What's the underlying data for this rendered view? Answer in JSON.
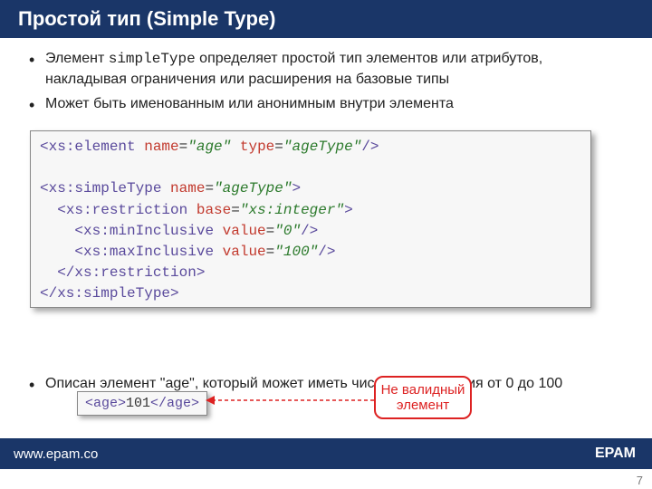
{
  "header": {
    "title": "Простой тип (Simple Type)"
  },
  "bullets": {
    "b1_pre": "Элемент ",
    "b1_code": "simpleType",
    "b1_post": " определяет простой тип элементов или атрибутов, накладывая ограничения или расширения на базовые типы",
    "b2": "Может быть именованным или анонимным внутри элемента",
    "b3": "Описан элемент \"age\", который может иметь числовые значения от 0 до 100"
  },
  "code": {
    "l1a": "<",
    "l1b": "xs:element",
    "l1c": " name",
    "l1d": "=",
    "l1e": "\"age\"",
    "l1f": " type",
    "l1g": "=",
    "l1h": "\"ageType\"",
    "l1i": "/>",
    "l2": "",
    "l3a": "<",
    "l3b": "xs:simpleType",
    "l3c": " name",
    "l3d": "=",
    "l3e": "\"ageType\"",
    "l3f": ">",
    "l4a": "  <",
    "l4b": "xs:restriction",
    "l4c": " base",
    "l4d": "=",
    "l4e": "\"xs:integer\"",
    "l4f": ">",
    "l5a": "    <",
    "l5b": "xs:minInclusive",
    "l5c": " value",
    "l5d": "=",
    "l5e": "\"0\"",
    "l5f": "/>",
    "l6a": "    <",
    "l6b": "xs:maxInclusive",
    "l6c": " value",
    "l6d": "=",
    "l6e": "\"100\"",
    "l6f": "/>",
    "l7a": "  </",
    "l7b": "xs:restriction",
    "l7c": ">",
    "l8a": "</",
    "l8b": "xs:simpleType",
    "l8c": ">"
  },
  "age": {
    "open": "<age>",
    "val": "101",
    "close": "</age>"
  },
  "callout": {
    "text": "Не валидный элемент"
  },
  "footer": {
    "url": "www.epam.co",
    "brand": "EPAM"
  },
  "page": {
    "num": "7"
  }
}
